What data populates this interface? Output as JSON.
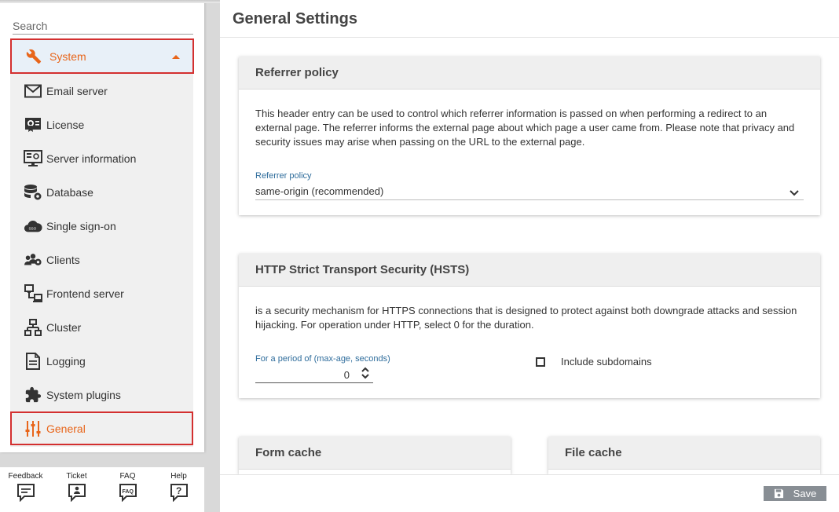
{
  "sidebar": {
    "search_placeholder": "Search",
    "section": {
      "label": "System",
      "expanded": true,
      "accent_color": "#e8651a"
    },
    "items": [
      {
        "label": "Email server",
        "icon": "envelope-icon"
      },
      {
        "label": "License",
        "icon": "license-certificate-icon"
      },
      {
        "label": "Server information",
        "icon": "server-monitor-icon"
      },
      {
        "label": "Database",
        "icon": "database-gear-icon"
      },
      {
        "label": "Single sign-on",
        "icon": "sso-cloud-icon"
      },
      {
        "label": "Clients",
        "icon": "users-gear-icon"
      },
      {
        "label": "Frontend server",
        "icon": "frontend-network-icon"
      },
      {
        "label": "Cluster",
        "icon": "cluster-sitemap-icon"
      },
      {
        "label": "Logging",
        "icon": "log-file-icon"
      },
      {
        "label": "System plugins",
        "icon": "puzzle-icon"
      },
      {
        "label": "General",
        "icon": "sliders-icon",
        "active": true
      }
    ]
  },
  "helpbar": [
    {
      "label": "Feedback",
      "icon": "feedback-icon"
    },
    {
      "label": "Ticket",
      "icon": "ticket-icon"
    },
    {
      "label": "FAQ",
      "icon": "faq-icon",
      "badge": "FAQ"
    },
    {
      "label": "Help",
      "icon": "help-icon",
      "badge": "?"
    }
  ],
  "main": {
    "title": "General Settings",
    "referrer": {
      "title": "Referrer policy",
      "description": "This header entry can be used to control which referrer information is passed on when performing a redirect to an external page. The referrer informs the external page about which page a user came from. Please note that privacy and security issues may arise when passing on the URL to the external page.",
      "field_label": "Referrer policy",
      "value": "same-origin (recommended)"
    },
    "hsts": {
      "title": "HTTP Strict Transport Security (HSTS)",
      "description": "is a security mechanism for HTTPS connections that is designed to protect against both downgrade attacks and session hijacking. For operation under HTTP, select 0 for the duration.",
      "period_label": "For a period of (max-age, seconds)",
      "period_value": "0",
      "include_subdomains_label": "Include subdomains",
      "include_subdomains_checked": false
    },
    "form_cache": {
      "title": "Form cache"
    },
    "file_cache": {
      "title": "File cache"
    },
    "save_label": "Save"
  },
  "colors": {
    "accent": "#e8651a",
    "highlight_border": "#d32f2f",
    "label_blue": "#2f6d9c",
    "save_button": "#888e94"
  }
}
